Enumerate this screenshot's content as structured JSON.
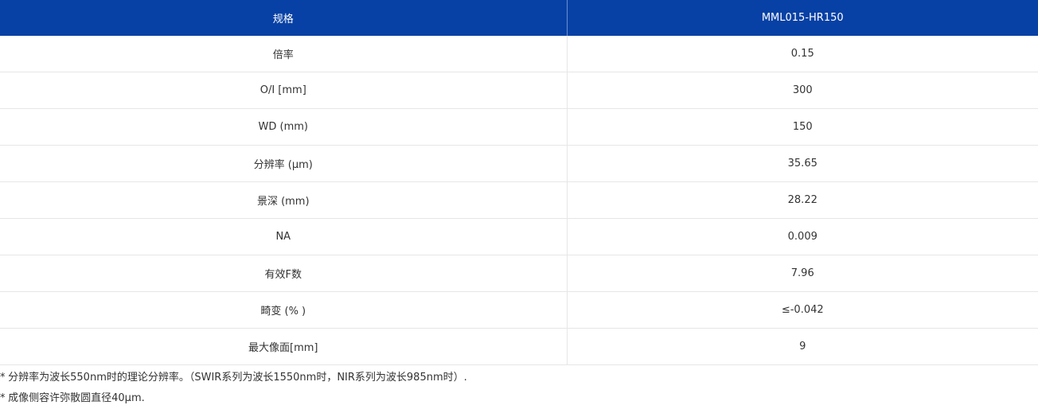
{
  "table": {
    "headers": [
      "规格",
      "MML015-HR150"
    ],
    "rows": [
      {
        "label": "倍率",
        "value": "0.15"
      },
      {
        "label": "O/I [mm]",
        "value": "300"
      },
      {
        "label": "WD (mm)",
        "value": "150"
      },
      {
        "label": "分辨率 (µm)",
        "value": "35.65"
      },
      {
        "label": "景深 (mm)",
        "value": "28.22"
      },
      {
        "label": "NA",
        "value": "0.009"
      },
      {
        "label": "有效F数",
        "value": "7.96"
      },
      {
        "label": "畸变 (% )",
        "value": "≤-0.042"
      },
      {
        "label": "最大像面[mm]",
        "value": "9"
      }
    ]
  },
  "notes": [
    {
      "mark": "*",
      "text": "分辨率为波长550nm时的理论分辨率。（SWIR系列为波长1550nm时，NIR系列为波长985nm时）."
    },
    {
      "mark": "*",
      "text": "成像侧容许弥散圆直径40µm."
    }
  ],
  "colors": {
    "header_bg": "#0741a5",
    "header_text": "#ffffff",
    "border": "#e6e6e6"
  }
}
